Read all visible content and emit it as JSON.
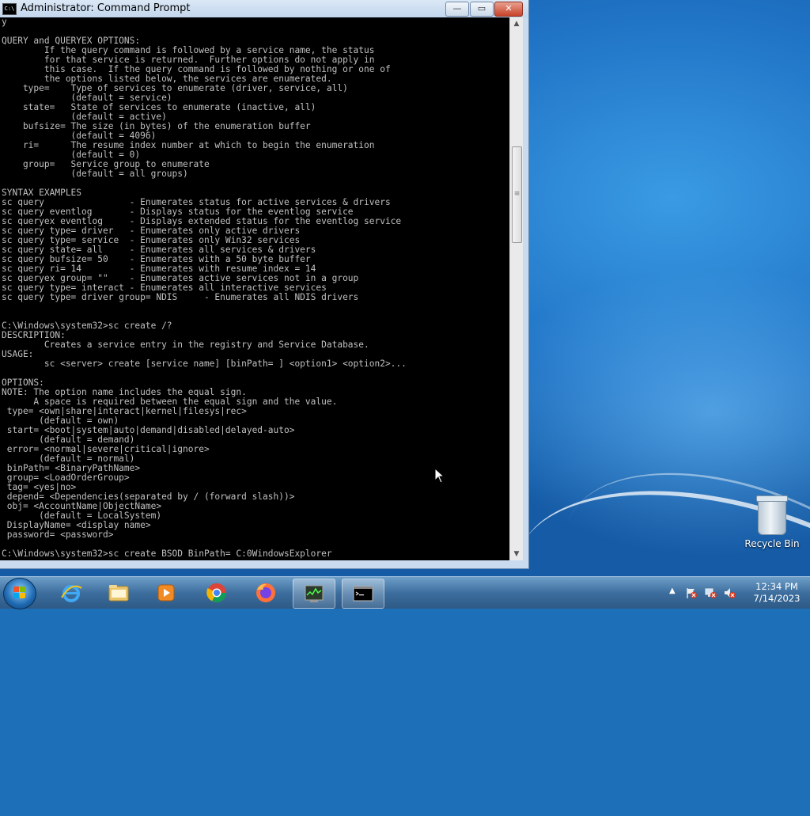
{
  "window": {
    "title": "Administrator: Command Prompt",
    "icon_text": "C:\\",
    "controls": {
      "minimize": "—",
      "maximize": "▭",
      "close": "✕"
    }
  },
  "console": {
    "lines": [
      "y",
      "",
      "QUERY and QUERYEX OPTIONS:",
      "        If the query command is followed by a service name, the status",
      "        for that service is returned.  Further options do not apply in",
      "        this case.  If the query command is followed by nothing or one of",
      "        the options listed below, the services are enumerated.",
      "    type=    Type of services to enumerate (driver, service, all)",
      "             (default = service)",
      "    state=   State of services to enumerate (inactive, all)",
      "             (default = active)",
      "    bufsize= The size (in bytes) of the enumeration buffer",
      "             (default = 4096)",
      "    ri=      The resume index number at which to begin the enumeration",
      "             (default = 0)",
      "    group=   Service group to enumerate",
      "             (default = all groups)",
      "",
      "SYNTAX EXAMPLES",
      "sc query                - Enumerates status for active services & drivers",
      "sc query eventlog       - Displays status for the eventlog service",
      "sc queryex eventlog     - Displays extended status for the eventlog service",
      "sc query type= driver   - Enumerates only active drivers",
      "sc query type= service  - Enumerates only Win32 services",
      "sc query state= all     - Enumerates all services & drivers",
      "sc query bufsize= 50    - Enumerates with a 50 byte buffer",
      "sc query ri= 14         - Enumerates with resume index = 14",
      "sc queryex group= \"\"    - Enumerates active services not in a group",
      "sc query type= interact - Enumerates all interactive services",
      "sc query type= driver group= NDIS     - Enumerates all NDIS drivers",
      "",
      "",
      "C:\\Windows\\system32>sc create /?",
      "DESCRIPTION:",
      "        Creates a service entry in the registry and Service Database.",
      "USAGE:",
      "        sc <server> create [service name] [binPath= ] <option1> <option2>...",
      "",
      "OPTIONS:",
      "NOTE: The option name includes the equal sign.",
      "      A space is required between the equal sign and the value.",
      " type= <own|share|interact|kernel|filesys|rec>",
      "       (default = own)",
      " start= <boot|system|auto|demand|disabled|delayed-auto>",
      "       (default = demand)",
      " error= <normal|severe|critical|ignore>",
      "       (default = normal)",
      " binPath= <BinaryPathName>",
      " group= <LoadOrderGroup>",
      " tag= <yes|no>",
      " depend= <Dependencies(separated by / (forward slash))>",
      " obj= <AccountName|ObjectName>",
      "       (default = LocalSystem)",
      " DisplayName= <display name>",
      " password= <password>",
      "",
      "C:\\Windows\\system32>sc create BSOD BinPath= C:0WindowsExplorer"
    ]
  },
  "scrollbar": {
    "up": "▲",
    "down": "▼",
    "grip": "≡"
  },
  "desktop": {
    "recycle_bin_label": "Recycle Bin"
  },
  "taskbar": {
    "items": [
      {
        "name": "internet-explorer",
        "active": false
      },
      {
        "name": "file-explorer",
        "active": false
      },
      {
        "name": "media-player",
        "active": false
      },
      {
        "name": "chrome",
        "active": false
      },
      {
        "name": "firefox",
        "active": false
      },
      {
        "name": "task-window",
        "active": true
      },
      {
        "name": "command-prompt",
        "active": true
      }
    ],
    "clock_time": "12:34 PM",
    "clock_date": "7/14/2023",
    "tray_chevron": "▲"
  },
  "colors": {
    "console_bg": "#000000",
    "console_fg": "#c0c0c0",
    "accent": "#1f72c4"
  }
}
